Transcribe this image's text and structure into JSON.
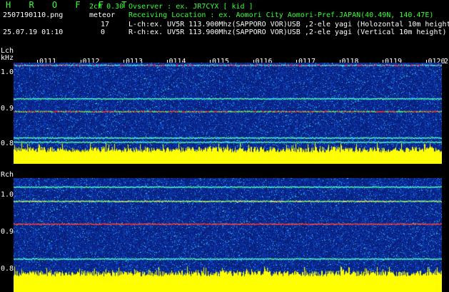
{
  "header": {
    "app_title": "H R O F F T",
    "version": "2ch 0.30",
    "mode": "meteor",
    "filename": "2507190110.png",
    "datetime": "25.07.19 01:10",
    "count_l": "17",
    "count_r": "0",
    "observer_line": "Ovserver            : ex. JR7CYX [ kid ]",
    "location_line": "Receiving Location : ex. Aomori City Aomori-Pref.JAPAN(40.49N, 140.47E)",
    "lch_line": "L-ch:ex. UV5R 113.900Mhz(SAPPORO VOR)USB ,2-ele yagi (Holozontal 10m height)",
    "rch_line": "R-ch:ex. UV5R 113.900Mhz(SAPPORO VOR)USB ,2-ele yagi (Vertical 10m height)"
  },
  "lch": {
    "label": "Lch",
    "unit": "kHz",
    "yticks": [
      "1.0",
      "0.9",
      "0.8"
    ]
  },
  "rch": {
    "label": "Rch",
    "yticks": [
      "1.0",
      "0.9",
      "0.8"
    ]
  },
  "time_marks": [
    "0111",
    "0112",
    "0113",
    "0114",
    "0115",
    "0116",
    "0117",
    "0118",
    "0119",
    "0120"
  ],
  "edge_label": "2",
  "colors": {
    "background": "#000000",
    "header_green": "#33ff33",
    "amplitude_yellow": "#ffff00",
    "noise_blue": "#1030c0",
    "signal_red": "#ff3030",
    "signal_cyan": "#40ffff"
  }
}
